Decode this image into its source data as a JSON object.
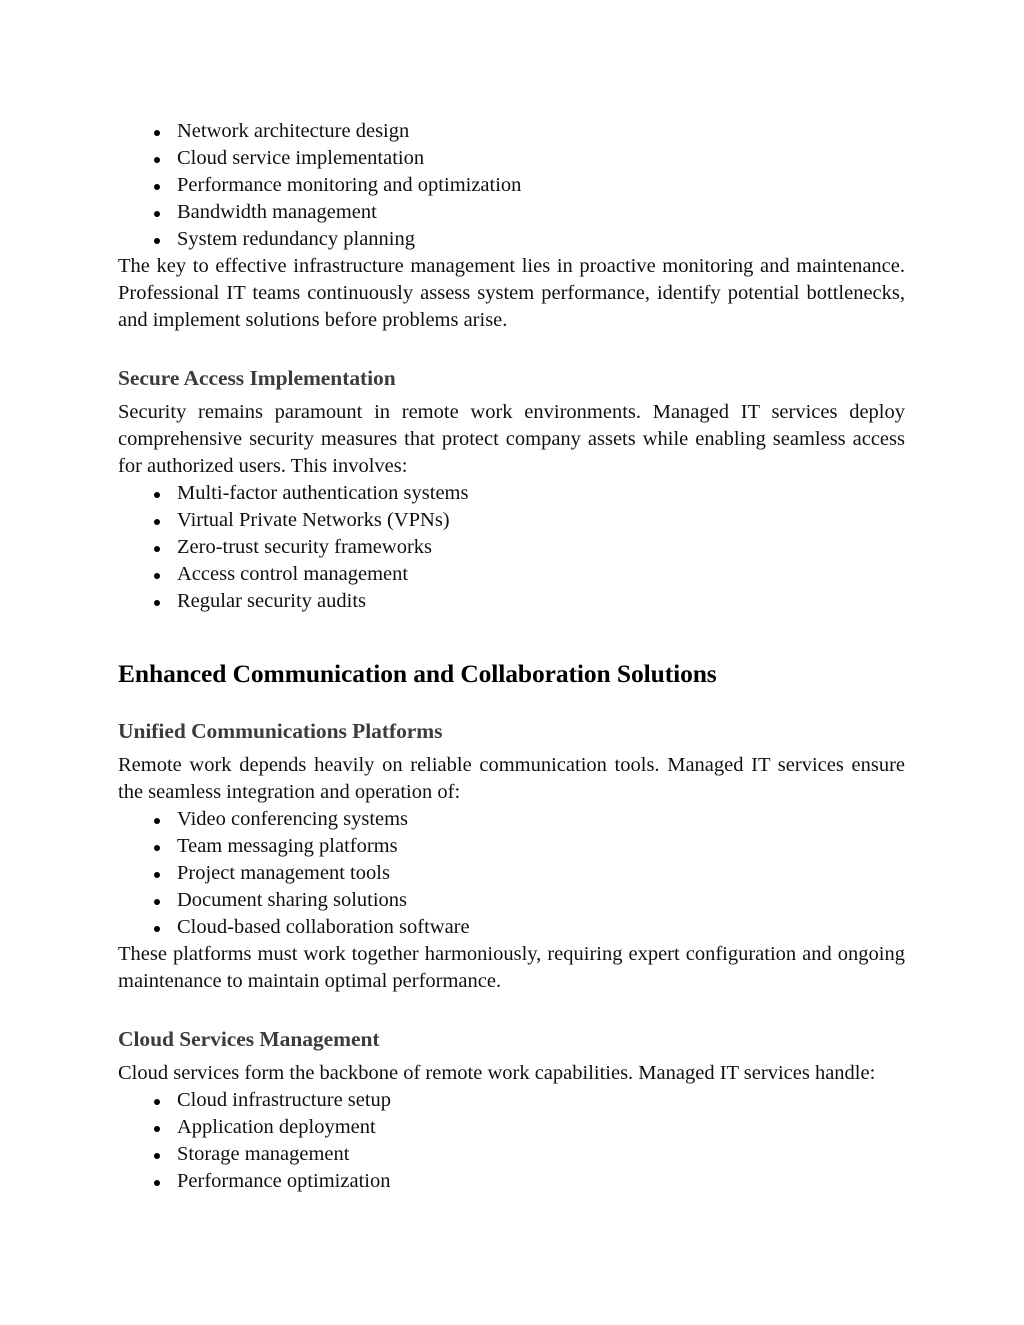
{
  "document": {
    "blocks": [
      {
        "type": "list",
        "name": "infrastructure-capabilities-list",
        "items": [
          "Network architecture design",
          "Cloud service implementation",
          "Performance monitoring and optimization",
          "Bandwidth management",
          "System redundancy planning"
        ]
      },
      {
        "type": "paragraph",
        "name": "infrastructure-management-paragraph",
        "text": "The key to effective infrastructure management lies in proactive monitoring and maintenance. Professional IT teams continuously assess system performance, identify potential bottlenecks, and implement solutions before problems arise."
      },
      {
        "type": "heading3",
        "name": "secure-access-implementation-heading",
        "text": "Secure Access Implementation"
      },
      {
        "type": "paragraph",
        "name": "security-intro-paragraph",
        "text": "Security remains paramount in remote work environments. Managed IT services deploy comprehensive security measures that protect company assets while enabling seamless access for authorized users. This involves:"
      },
      {
        "type": "list",
        "name": "security-measures-list",
        "items": [
          "Multi-factor authentication systems",
          "Virtual Private Networks (VPNs)",
          "Zero-trust security frameworks",
          "Access control management",
          "Regular security audits"
        ]
      },
      {
        "type": "heading2",
        "name": "enhanced-communication-heading",
        "text": "Enhanced Communication and Collaboration Solutions"
      },
      {
        "type": "heading3",
        "name": "unified-communications-platforms-heading",
        "text": "Unified Communications Platforms"
      },
      {
        "type": "paragraph",
        "name": "communication-intro-paragraph",
        "text": "Remote work depends heavily on reliable communication tools. Managed IT services ensure the seamless integration and operation of:"
      },
      {
        "type": "list",
        "name": "communication-tools-list",
        "items": [
          "Video conferencing systems",
          "Team messaging platforms",
          "Project management tools",
          "Document sharing solutions",
          "Cloud-based collaboration software"
        ]
      },
      {
        "type": "paragraph",
        "name": "platforms-harmony-paragraph",
        "text": "These platforms must work together harmoniously, requiring expert configuration and ongoing maintenance to maintain optimal performance."
      },
      {
        "type": "heading3",
        "name": "cloud-services-management-heading",
        "text": "Cloud Services Management"
      },
      {
        "type": "paragraph",
        "name": "cloud-services-intro-paragraph",
        "text": "Cloud services form the backbone of remote work capabilities. Managed IT services handle:"
      },
      {
        "type": "list",
        "name": "cloud-services-list",
        "items": [
          "Cloud infrastructure setup",
          "Application deployment",
          "Storage management",
          "Performance optimization"
        ]
      }
    ]
  },
  "theme": {
    "page_background": "#ffffff",
    "body_text_color": "#101010",
    "heading2_color": "#000000",
    "heading3_color": "#3c3c3c",
    "bullet_color": "#000000"
  }
}
